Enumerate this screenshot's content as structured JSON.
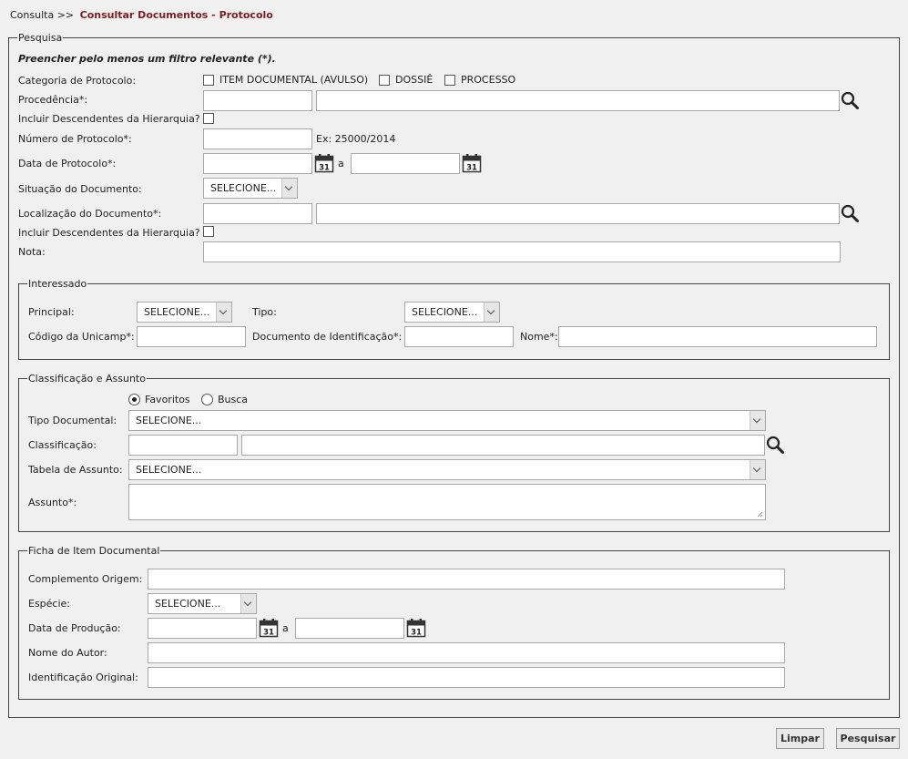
{
  "breadcrumb": {
    "root": "Consulta",
    "separator": ">>",
    "current": "Consultar Documentos - Protocolo"
  },
  "colors": {
    "accent": "#7a1f1f",
    "border": "#444444"
  },
  "pesquisa": {
    "legend": "Pesquisa",
    "hint": "Preencher pelo menos um filtro relevante (*).",
    "categoria_label": "Categoria de Protocolo:",
    "categoria_options": [
      "ITEM DOCUMENTAL (AVULSO)",
      "DOSSIÊ",
      "PROCESSO"
    ],
    "procedencia_label": "Procedência*:",
    "incluir_desc_label": "Incluir Descendentes da Hierarquia?",
    "numero_label": "Número de Protocolo*:",
    "numero_hint": "Ex: 25000/2014",
    "data_label": "Data de Protocolo*:",
    "a_label": "a",
    "situacao_label": "Situação do Documento:",
    "situacao_value": "SELECIONE...",
    "localizacao_label": "Localização do Documento*:",
    "incluir_desc2_label": "Incluir Descendentes da Hierarquia?",
    "nota_label": "Nota:"
  },
  "interessado": {
    "legend": "Interessado",
    "principal_label": "Principal:",
    "principal_value": "SELECIONE...",
    "tipo_label": "Tipo:",
    "tipo_value": "SELECIONE...",
    "codigo_label": "Código da Unicamp*:",
    "documento_label": "Documento de Identificação*:",
    "nome_label": "Nome*:"
  },
  "classificacao": {
    "legend": "Classificação e Assunto",
    "radio_favoritos": "Favoritos",
    "radio_busca": "Busca",
    "tipo_doc_label": "Tipo Documental:",
    "tipo_doc_value": "SELECIONE...",
    "classificacao_label": "Classificação:",
    "tabela_label": "Tabela de Assunto:",
    "tabela_value": "SELECIONE...",
    "assunto_label": "Assunto*:"
  },
  "ficha": {
    "legend": "Ficha de Item Documental",
    "complemento_label": "Complemento Origem:",
    "especie_label": "Espécie:",
    "especie_value": "SELECIONE...",
    "data_producao_label": "Data de Produção:",
    "a_label": "a",
    "autor_label": "Nome do Autor:",
    "ident_label": "Identificação Original:"
  },
  "calendar_day": "31",
  "buttons": {
    "limpar": "Limpar",
    "pesquisar": "Pesquisar"
  }
}
